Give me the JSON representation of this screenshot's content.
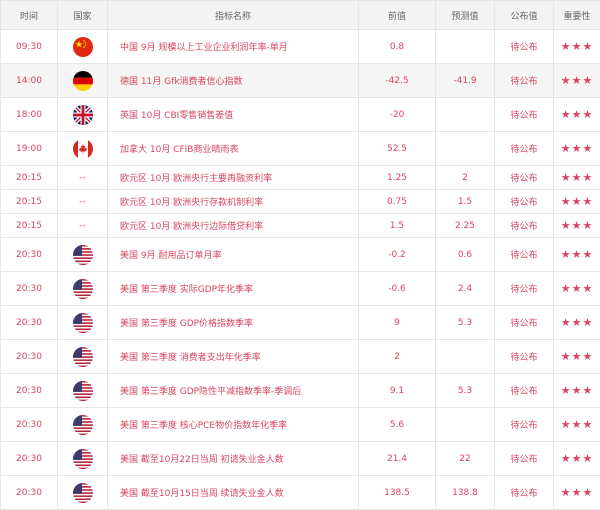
{
  "headers": {
    "time": "时间",
    "country": "国家",
    "indicator": "指标名称",
    "previous": "前值",
    "forecast": "预测值",
    "actual": "公布值",
    "importance": "重要性"
  },
  "rows": [
    {
      "time": "09:30",
      "flag": "cn-flag-icon",
      "name": "中国 9月 规模以上工业企业利润年率-单月",
      "previous": "0.8",
      "forecast": "",
      "actual": "待公布",
      "importance": 3
    },
    {
      "time": "14:00",
      "flag": "de-flag-icon",
      "name": "德国 11月 Gfk消费者信心指数",
      "previous": "-42.5",
      "forecast": "-41.9",
      "actual": "待公布",
      "importance": 3
    },
    {
      "time": "18:00",
      "flag": "gb-flag-icon",
      "name": "英国 10月 CBI零售销售差值",
      "previous": "-20",
      "forecast": "",
      "actual": "待公布",
      "importance": 3
    },
    {
      "time": "19:00",
      "flag": "ca-flag-icon",
      "name": "加拿大 10月 CFIB商业晴雨表",
      "previous": "52.5",
      "forecast": "",
      "actual": "待公布",
      "importance": 3
    },
    {
      "time": "20:15",
      "country_text": "--",
      "name": "欧元区 10月 欧洲央行主要再融资利率",
      "previous": "1.25",
      "forecast": "2",
      "actual": "待公布",
      "importance": 3
    },
    {
      "time": "20:15",
      "country_text": "--",
      "name": "欧元区 10月 欧洲央行存款机制利率",
      "previous": "0.75",
      "forecast": "1.5",
      "actual": "待公布",
      "importance": 3
    },
    {
      "time": "20:15",
      "country_text": "--",
      "name": "欧元区 10月 欧洲央行边际借贷利率",
      "previous": "1.5",
      "forecast": "2.25",
      "actual": "待公布",
      "importance": 3
    },
    {
      "time": "20:30",
      "flag": "us-flag-icon",
      "name": "美国 9月 耐用品订单月率",
      "previous": "-0.2",
      "forecast": "0.6",
      "actual": "待公布",
      "importance": 3
    },
    {
      "time": "20:30",
      "flag": "us-flag-icon",
      "name": "美国 第三季度 实际GDP年化季率",
      "previous": "-0.6",
      "forecast": "2.4",
      "actual": "待公布",
      "importance": 3
    },
    {
      "time": "20:30",
      "flag": "us-flag-icon",
      "name": "美国 第三季度 GDP价格指数季率",
      "previous": "9",
      "forecast": "5.3",
      "actual": "待公布",
      "importance": 3
    },
    {
      "time": "20:30",
      "flag": "us-flag-icon",
      "name": "美国 第三季度 消费者支出年化季率",
      "previous": "2",
      "forecast": "",
      "actual": "待公布",
      "importance": 3
    },
    {
      "time": "20:30",
      "flag": "us-flag-icon",
      "name": "美国 第三季度 GDP隐性平减指数季率-季调后",
      "previous": "9.1",
      "forecast": "5.3",
      "actual": "待公布",
      "importance": 3
    },
    {
      "time": "20:30",
      "flag": "us-flag-icon",
      "name": "美国 第三季度 核心PCE物价指数年化季率",
      "previous": "5.6",
      "forecast": "",
      "actual": "待公布",
      "importance": 3
    },
    {
      "time": "20:30",
      "flag": "us-flag-icon",
      "name": "美国 截至10月22日当周 初请失业金人数",
      "previous": "21.4",
      "forecast": "22",
      "actual": "待公布",
      "importance": 3
    },
    {
      "time": "20:30",
      "flag": "us-flag-icon",
      "name": "美国 截至10月15日当周 续请失业金人数",
      "previous": "138.5",
      "forecast": "138.8",
      "actual": "待公布",
      "importance": 3
    }
  ],
  "colors": {
    "text_accent": "#d9455f",
    "star": "#f3a51d",
    "header_bg": "#f3f3f3",
    "row_shade": "#f5f5f5",
    "border": "#e6e6e6"
  }
}
